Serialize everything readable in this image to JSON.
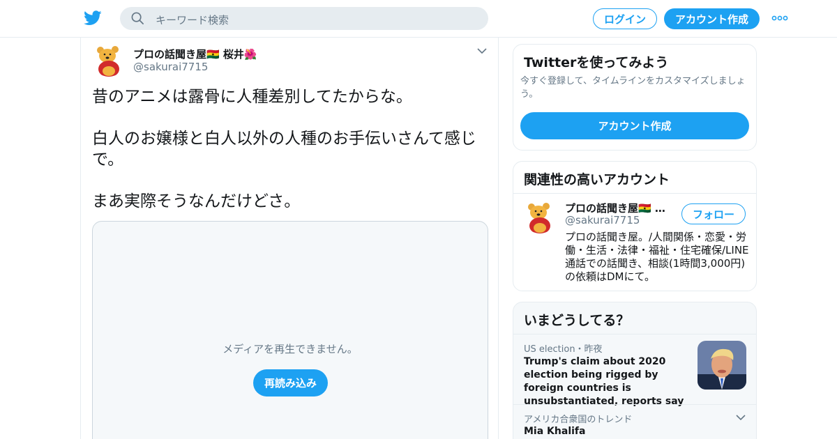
{
  "header": {
    "logo_icon": "twitter-bird-icon",
    "search_placeholder": "キーワード検索",
    "login_label": "ログイン",
    "signup_label": "アカウント作成",
    "more_icon": "more-dots-icon"
  },
  "tweet": {
    "author_name": "プロの話聞き屋🇬🇭 桜井🌺",
    "author_handle": "@sakurai7715",
    "lines": [
      "昔のアニメは露骨に人種差別してたからな。",
      "",
      "白人のお嬢様と白人以外の人種のお手伝いさんて感じで。",
      "",
      "まあ実際そうなんだけどさ。"
    ],
    "media_message": "メディアを再生できません。",
    "reload_label": "再読み込み"
  },
  "try_twitter": {
    "title": "Twitterを使ってみよう",
    "description": "今すぐ登録して、タイムラインをカスタマイズしましょう。",
    "button_label": "アカウント作成"
  },
  "related": {
    "title": "関連性の高いアカウント",
    "account_name": "プロの話聞き屋🇬🇭 …",
    "account_handle": "@sakurai7715",
    "follow_label": "フォロー",
    "bio": "プロの話聞き屋。/人間関係・恋愛・労働・生活・法律・福祉・住宅確保/LINE通話での話聞き、相談(1時間3,000円)の依頼はDMにて。"
  },
  "trends": {
    "title": "いまどうしてる？",
    "items": [
      {
        "meta": "US election・昨夜",
        "text": "Trump's claim about 2020 election being rigged by foreign countries is unsubstantiated, reports say"
      },
      {
        "meta": "アメリカ合衆国のトレンド",
        "text": "Mia Khalifa"
      }
    ]
  },
  "colors": {
    "accent": "#1da1f2",
    "text": "#14171a",
    "muted": "#657786",
    "border": "#e6ecf0"
  }
}
